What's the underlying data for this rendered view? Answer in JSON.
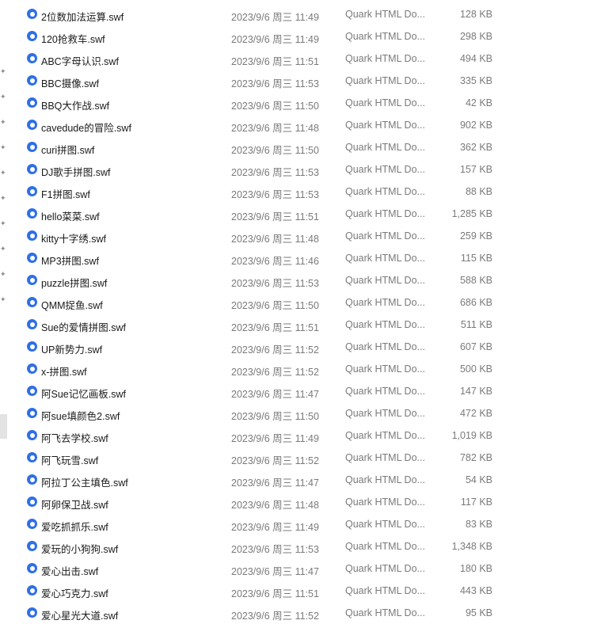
{
  "files": [
    {
      "name": "2位数加法运算.swf",
      "date": "2023/9/6 周三 11:49",
      "type": "Quark HTML Do...",
      "size": "128 KB"
    },
    {
      "name": "120抢救车.swf",
      "date": "2023/9/6 周三 11:49",
      "type": "Quark HTML Do...",
      "size": "298 KB"
    },
    {
      "name": "ABC字母认识.swf",
      "date": "2023/9/6 周三 11:51",
      "type": "Quark HTML Do...",
      "size": "494 KB"
    },
    {
      "name": "BBC摄像.swf",
      "date": "2023/9/6 周三 11:53",
      "type": "Quark HTML Do...",
      "size": "335 KB"
    },
    {
      "name": "BBQ大作战.swf",
      "date": "2023/9/6 周三 11:50",
      "type": "Quark HTML Do...",
      "size": "42 KB"
    },
    {
      "name": "cavedude的冒险.swf",
      "date": "2023/9/6 周三 11:48",
      "type": "Quark HTML Do...",
      "size": "902 KB"
    },
    {
      "name": "curi拼图.swf",
      "date": "2023/9/6 周三 11:50",
      "type": "Quark HTML Do...",
      "size": "362 KB"
    },
    {
      "name": "DJ歌手拼图.swf",
      "date": "2023/9/6 周三 11:53",
      "type": "Quark HTML Do...",
      "size": "157 KB"
    },
    {
      "name": "F1拼图.swf",
      "date": "2023/9/6 周三 11:53",
      "type": "Quark HTML Do...",
      "size": "88 KB"
    },
    {
      "name": "hello菜菜.swf",
      "date": "2023/9/6 周三 11:51",
      "type": "Quark HTML Do...",
      "size": "1,285 KB"
    },
    {
      "name": "kitty十字绣.swf",
      "date": "2023/9/6 周三 11:48",
      "type": "Quark HTML Do...",
      "size": "259 KB"
    },
    {
      "name": "MP3拼图.swf",
      "date": "2023/9/6 周三 11:46",
      "type": "Quark HTML Do...",
      "size": "115 KB"
    },
    {
      "name": "puzzle拼图.swf",
      "date": "2023/9/6 周三 11:53",
      "type": "Quark HTML Do...",
      "size": "588 KB"
    },
    {
      "name": "QMM捉鱼.swf",
      "date": "2023/9/6 周三 11:50",
      "type": "Quark HTML Do...",
      "size": "686 KB"
    },
    {
      "name": "Sue的爱情拼图.swf",
      "date": "2023/9/6 周三 11:51",
      "type": "Quark HTML Do...",
      "size": "511 KB"
    },
    {
      "name": "UP新势力.swf",
      "date": "2023/9/6 周三 11:52",
      "type": "Quark HTML Do...",
      "size": "607 KB"
    },
    {
      "name": "x-拼图.swf",
      "date": "2023/9/6 周三 11:52",
      "type": "Quark HTML Do...",
      "size": "500 KB"
    },
    {
      "name": "阿Sue记忆画板.swf",
      "date": "2023/9/6 周三 11:47",
      "type": "Quark HTML Do...",
      "size": "147 KB"
    },
    {
      "name": "阿sue填颜色2.swf",
      "date": "2023/9/6 周三 11:50",
      "type": "Quark HTML Do...",
      "size": "472 KB"
    },
    {
      "name": "阿飞去学校.swf",
      "date": "2023/9/6 周三 11:49",
      "type": "Quark HTML Do...",
      "size": "1,019 KB"
    },
    {
      "name": "阿飞玩雪.swf",
      "date": "2023/9/6 周三 11:52",
      "type": "Quark HTML Do...",
      "size": "782 KB"
    },
    {
      "name": "阿拉丁公主填色.swf",
      "date": "2023/9/6 周三 11:47",
      "type": "Quark HTML Do...",
      "size": "54 KB"
    },
    {
      "name": "阿卵保卫战.swf",
      "date": "2023/9/6 周三 11:48",
      "type": "Quark HTML Do...",
      "size": "117 KB"
    },
    {
      "name": "爱吃抓抓乐.swf",
      "date": "2023/9/6 周三 11:49",
      "type": "Quark HTML Do...",
      "size": "83 KB"
    },
    {
      "name": "爱玩的小狗狗.swf",
      "date": "2023/9/6 周三 11:53",
      "type": "Quark HTML Do...",
      "size": "1,348 KB"
    },
    {
      "name": "爱心出击.swf",
      "date": "2023/9/6 周三 11:47",
      "type": "Quark HTML Do...",
      "size": "180 KB"
    },
    {
      "name": "爱心巧克力.swf",
      "date": "2023/9/6 周三 11:51",
      "type": "Quark HTML Do...",
      "size": "443 KB"
    },
    {
      "name": "爱心星光大道.swf",
      "date": "2023/9/6 周三 11:52",
      "type": "Quark HTML Do...",
      "size": "95 KB"
    }
  ],
  "icons": {
    "file_icon": "quark-html-file-icon",
    "pin_icon": "pin-icon"
  },
  "colors": {
    "file_icon": "#2f6fe4",
    "name_text": "#1a1a1a",
    "meta_text": "#7a7a7a"
  }
}
